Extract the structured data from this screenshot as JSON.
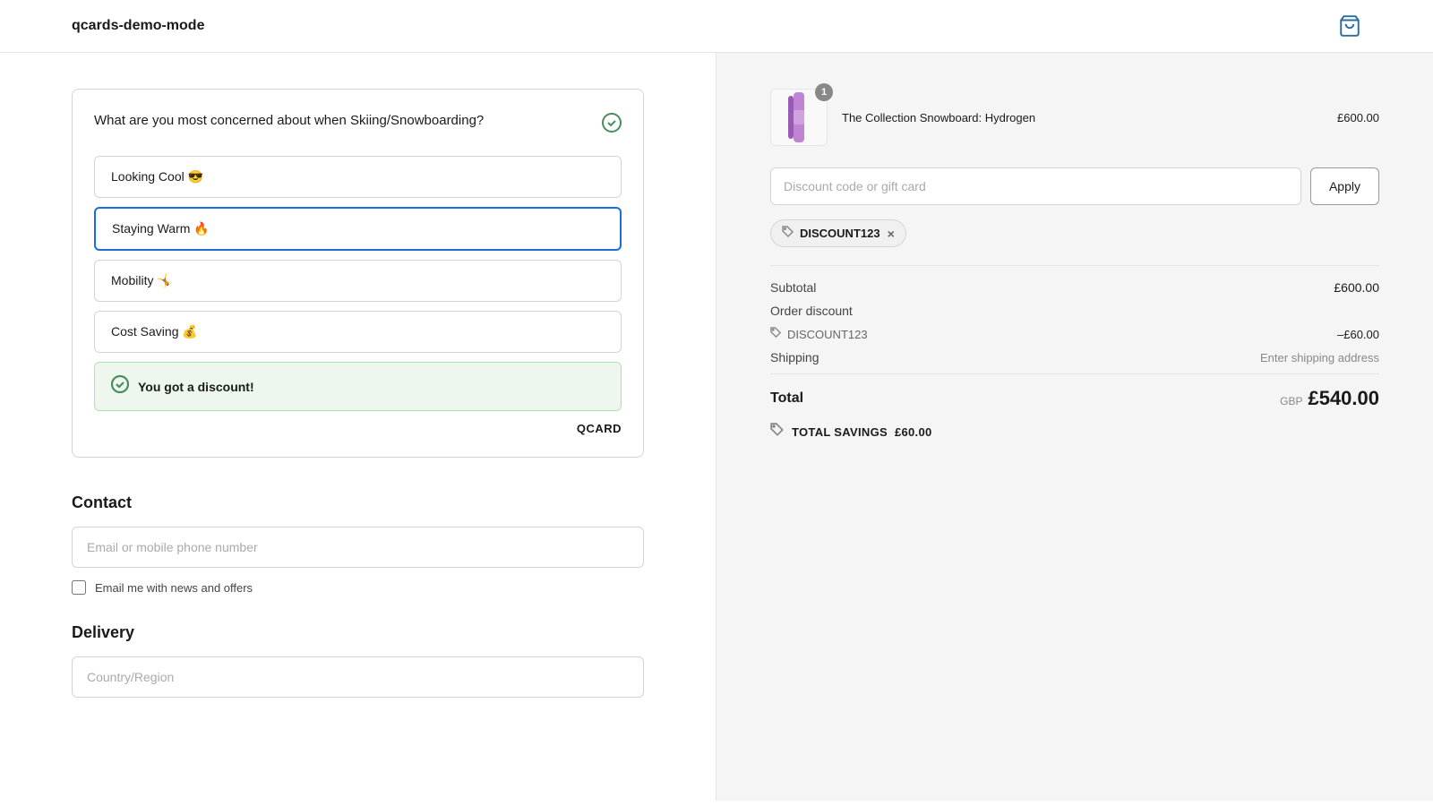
{
  "header": {
    "logo": "qcards-demo-mode",
    "cart_icon_label": "cart"
  },
  "qcard": {
    "question": "What are you most concerned about when Skiing/Snowboarding?",
    "check_icon": "✓",
    "options": [
      {
        "id": "looking-cool",
        "label": "Looking Cool 😎",
        "selected": false
      },
      {
        "id": "staying-warm",
        "label": "Staying Warm 🔥",
        "selected": true
      },
      {
        "id": "mobility",
        "label": "Mobility 🤸",
        "selected": false
      },
      {
        "id": "cost-saving",
        "label": "Cost Saving 💰",
        "selected": false
      }
    ],
    "discount_banner": {
      "text": "You got a discount!"
    },
    "branding": "QCARD"
  },
  "contact": {
    "section_title": "Contact",
    "email_placeholder": "Email or mobile phone number",
    "checkbox_label": "Email me with news and offers"
  },
  "delivery": {
    "section_title": "Delivery",
    "country_placeholder": "Country/Region"
  },
  "order_summary": {
    "product": {
      "name": "The Collection Snowboard: Hydrogen",
      "price": "£600.00",
      "badge": "1"
    },
    "discount_input": {
      "placeholder": "Discount code or gift card"
    },
    "apply_button": "Apply",
    "applied_code": "DISCOUNT123",
    "subtotal_label": "Subtotal",
    "subtotal_value": "£600.00",
    "order_discount_label": "Order discount",
    "discount_code_name": "DISCOUNT123",
    "discount_value": "–£60.00",
    "shipping_label": "Shipping",
    "shipping_value": "Enter shipping address",
    "total_label": "Total",
    "total_currency": "GBP",
    "total_value": "£540.00",
    "savings_label": "TOTAL SAVINGS",
    "savings_value": "£60.00"
  }
}
